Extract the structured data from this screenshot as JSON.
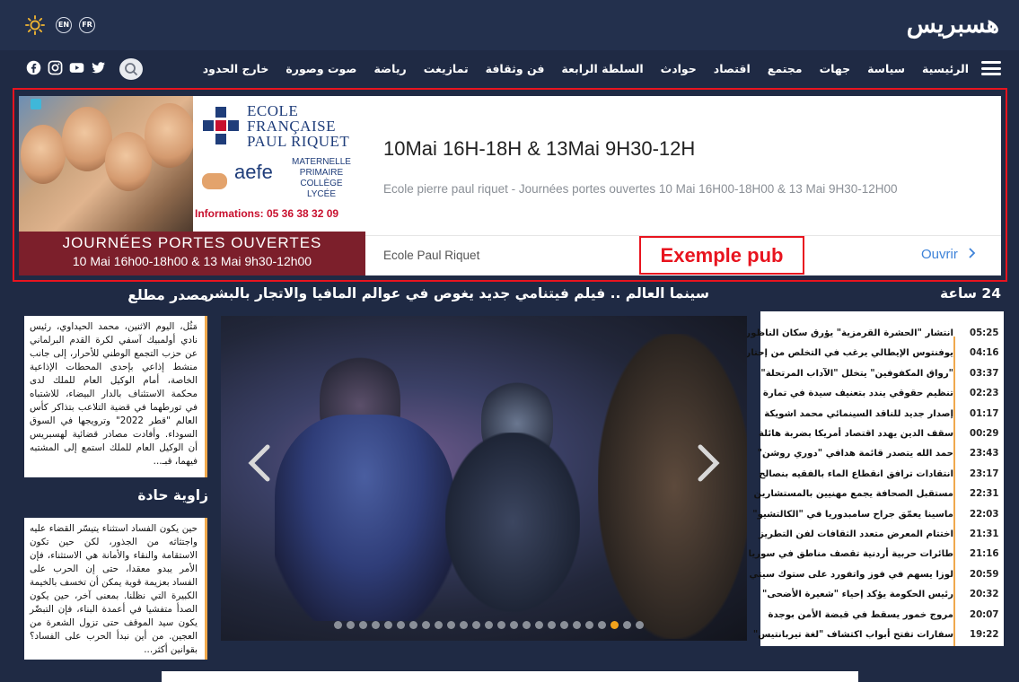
{
  "header": {
    "logo": "هسبريس",
    "lang_en": "EN",
    "lang_fr": "FR"
  },
  "nav": {
    "items": [
      "الرئيسية",
      "سياسة",
      "جهات",
      "مجتمع",
      "اقتصاد",
      "حوادث",
      "السلطة الرابعة",
      "فن وثقافة",
      "تمازيغت",
      "رياضة",
      "صوت وصورة",
      "خارج الحدود"
    ]
  },
  "ad": {
    "title": "10Mai 16H-18H & 13Mai 9H30-12H",
    "description": "Ecole pierre paul riquet - Journées portes ouvertes 10 Mai 16H00-18H00 & 13 Mai 9H30-12H00",
    "advertiser": "Ecole Paul Riquet",
    "cta": "Ouvrir",
    "annotation": "Exemple pub",
    "image_text": {
      "school_line1": "ECOLE",
      "school_line2": "FRANÇAISE",
      "school_line3": "PAUL RIQUET",
      "aefe": "aefe",
      "level1": "MATERNELLE",
      "level2": "PRIMAIRE",
      "level3": "COLLÈGE",
      "level4": "LYCÉE",
      "info": "Informations: 05 36 38 32 09",
      "band1": "JOURNÉES PORTES OUVERTES",
      "band2": "10 Mai 16h00-18h00 & 13 Mai 9h30-12h00"
    }
  },
  "sections": {
    "news24_title": "24 ساعة",
    "featured_title": "سينما العالم .. فيلم فيتنامي جديد يغوص في عوالم المافيا والاتجار بالبشر",
    "source_title": "مصدر مطلع",
    "angle_title": "زاوية حادة"
  },
  "news24": [
    {
      "time": "05:25",
      "text": "انتشار \"الحشرة القرمزية\" يؤرق سكان الناظور"
    },
    {
      "time": "04:16",
      "text": "يوفنتوس الإيطالي يرغب في التخلص من إحتارين"
    },
    {
      "time": "03:37",
      "text": "\"رواق المكفوفين\" يتخلل \"الآداب المرتحلة\""
    },
    {
      "time": "02:23",
      "text": "تنظيم حقوقي يندد بتعنيف سيدة في تمارة"
    },
    {
      "time": "01:17",
      "text": "إصدار جديد للناقد السينمائي محمد اشويكة"
    },
    {
      "time": "00:29",
      "text": "سقف الدين يهدد اقتصاد أمريكا بضربة هائلة"
    },
    {
      "time": "23:43",
      "text": "حمد الله يتصدر قائمة هدافي \"دوري روشن\""
    },
    {
      "time": "23:17",
      "text": "انتقادات ترافق انقطاع الماء بالفقيه بنصالح"
    },
    {
      "time": "22:31",
      "text": "مستقبل الصحافة يجمع مهنيين بالمستشارين"
    },
    {
      "time": "22:03",
      "text": "ماسينا يعمّق جراح سامبدوريا في \"الكالتشيو\""
    },
    {
      "time": "21:31",
      "text": "اختتام المعرض متعدد الثقافات لفن التطريز"
    },
    {
      "time": "21:16",
      "text": "طائرات حربية أردنية تقصف مناطق في سوريا"
    },
    {
      "time": "20:59",
      "text": "لوزا يسهم في فوز واتفورد على ستوك سيتي"
    },
    {
      "time": "20:32",
      "text": "رئيس الحكومة يؤكد إحياء \"شعيرة الأضحى\""
    },
    {
      "time": "20:07",
      "text": "مروج خمور يسقط في قبضة الأمن بوجدة"
    },
    {
      "time": "19:22",
      "text": "سفارات تفتح أبواب اكتشاف \"لغة تيربانتيس\""
    }
  ],
  "source_box": {
    "text": "مَثُل، اليوم الاثنين، محمد الحيداوي، رئيس نادي أولمبيك آسفي لكرة القدم البرلماني عن حزب التجمع الوطني للأحرار، إلى جانب منشط إذاعي بإحدى المحطات الإذاعية الخاصة، أمام الوكيل العام للملك لدى محكمة الاستئناف بالدار البيضاء، للاشتباه في تورطهما في قضية التلاعب بتذاكر كأس العالم \"قطر 2022\" وترويجها في السوق السوداء. وأفادت مصادر قضائية لهسبريس أن الوكيل العام للملك استمع إلى المشتبه فيهما، قبـ..."
  },
  "angle_box": {
    "text": "حين يكون الفساد استثناء يتيسّر القضاء عليه واجتثاثه من الجذور، لكن حين تكون الاستقامة والنقاء والأمانة هي الاستثناء، فإن الأمر يبدو معقدا، حتى إن الحرب على الفساد بعزيمة قوية يمكن أن تخسف بالخيمة الكبيرة التي نظلنا. بمعنى آخر، حين يكون الصدأ متفشيا في أعمدة البناء، فإن التبضّر يكون سيد الموقف حتى تزول الشعرة من العجين. من أين نبدأ الحرب على الفساد؟ بقوانين أكثر..."
  },
  "slider": {
    "dot_count": 25,
    "active_index": 22
  },
  "colors": {
    "background": "#1f2a44",
    "accent": "#f0a94d",
    "ad_frame": "#e8141f",
    "link": "#3d82d8"
  }
}
